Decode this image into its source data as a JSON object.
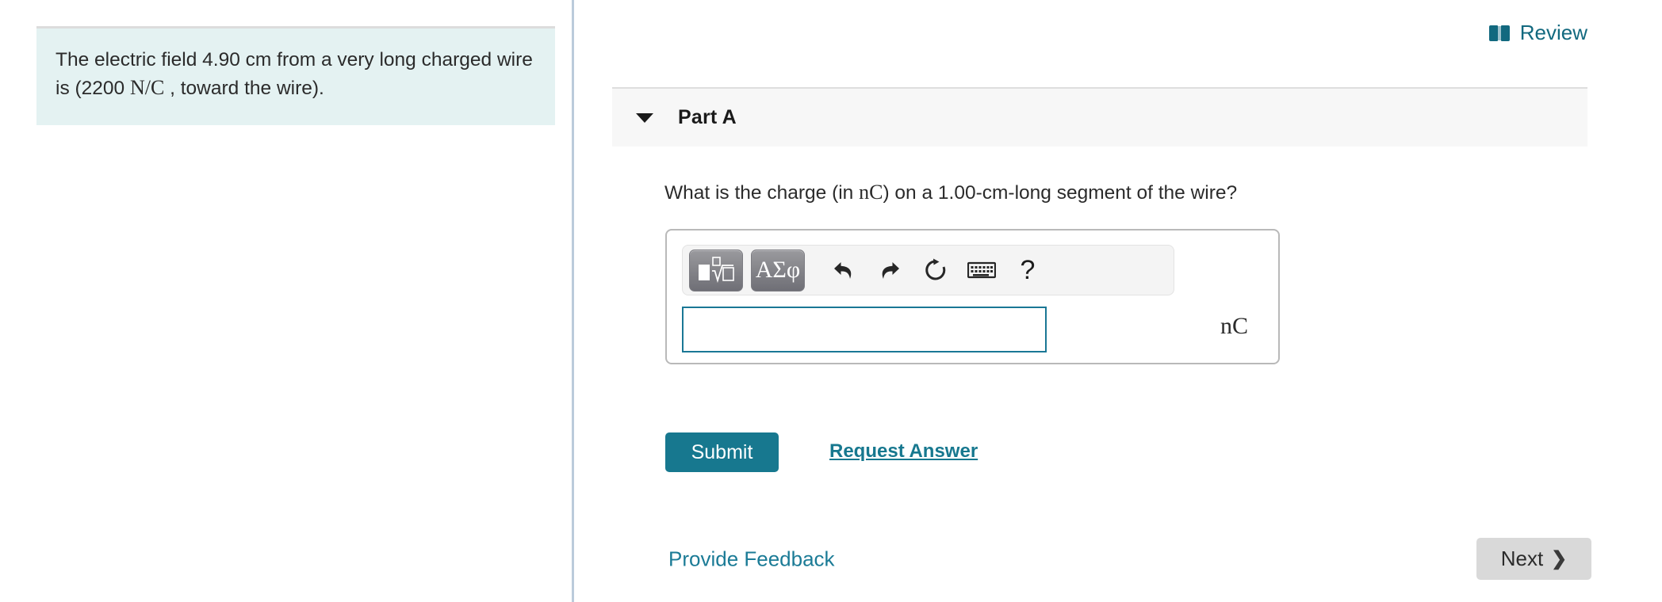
{
  "problem": {
    "statement_pre": "The electric field 4.90 cm from a very long charged wire is (2200 ",
    "statement_unit": "N/C",
    "statement_post": " , toward the wire)."
  },
  "header": {
    "review_label": "Review",
    "review_icon": "book-icon"
  },
  "part": {
    "title": "Part A",
    "caret_icon": "chevron-down-icon",
    "question_pre": "What is the charge (in ",
    "question_unit": "nC",
    "question_post": ") on a 1.00-cm-long segment of the wire?"
  },
  "answer": {
    "value": "",
    "placeholder": "",
    "unit": "nC",
    "toolbar": {
      "template_button_label": "math-template",
      "greek_button_label": "ΑΣφ",
      "undo_label": "undo-icon",
      "redo_label": "redo-icon",
      "reset_label": "reset-icon",
      "keyboard_label": "keyboard-icon",
      "help_label": "?"
    }
  },
  "actions": {
    "submit_label": "Submit",
    "request_answer_label": "Request Answer"
  },
  "footer": {
    "feedback_label": "Provide Feedback",
    "next_label": "Next",
    "next_icon": "chevron-right-icon"
  },
  "colors": {
    "accent_teal": "#17788f",
    "link_teal": "#1b7b96",
    "problem_bg": "#e4f2f2",
    "part_header_bg": "#f7f7f7",
    "next_bg": "#d9d9d9",
    "divider": "#bbcbdb",
    "input_border": "#1a7795"
  }
}
